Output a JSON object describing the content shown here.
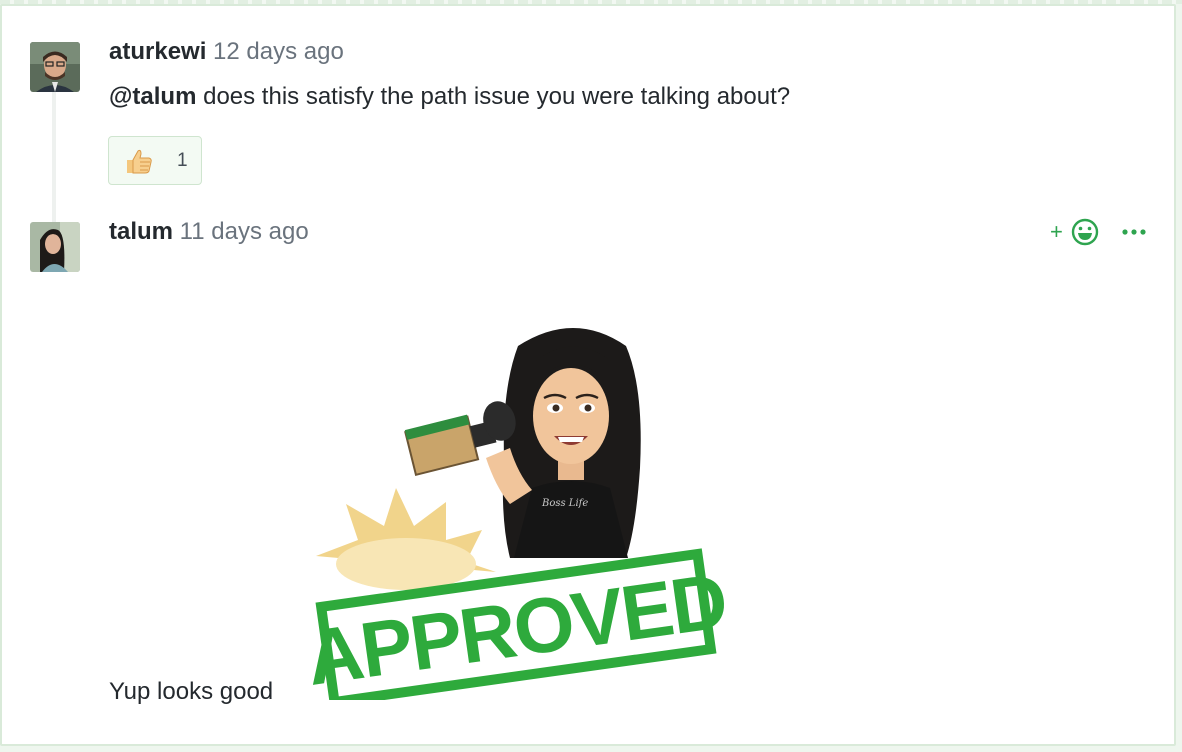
{
  "comments": [
    {
      "author": "aturkewi",
      "time": " 12 days ago",
      "mention": "@talum",
      "text": " does this satisfy the path issue you were talking about?",
      "reactions": [
        {
          "icon": "thumbs-up-icon",
          "count": "1"
        }
      ]
    },
    {
      "author": "talum",
      "time": " 11 days ago",
      "image_text": "APPROVED",
      "shirt_text": "Boss Life",
      "text": "Yup looks good"
    }
  ],
  "actions": {
    "add_reaction_plus": "+",
    "add_reaction_icon": "smiley-icon",
    "more_icon": "ellipsis-icon"
  },
  "colors": {
    "accent_green": "#2ea44f",
    "stamp_green": "#2eaa3c",
    "muted_text": "#6a737d",
    "primary_text": "#24292e"
  }
}
